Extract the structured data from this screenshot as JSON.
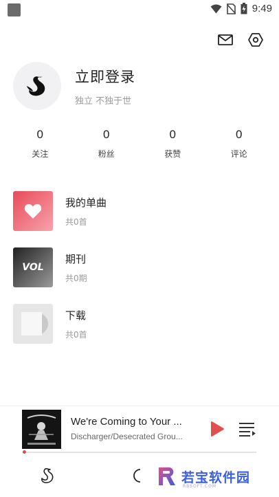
{
  "status_bar": {
    "time": "9:49",
    "icons": [
      "notification-square-icon",
      "wifi-icon",
      "no-sim-icon",
      "battery-icon"
    ]
  },
  "top_actions": {
    "icons": [
      "mail-icon",
      "settings-hexagon-icon"
    ]
  },
  "profile": {
    "title": "立即登录",
    "subtitle": "独立 不独于世"
  },
  "stats": [
    {
      "value": "0",
      "label": "关注"
    },
    {
      "value": "0",
      "label": "粉丝"
    },
    {
      "value": "0",
      "label": "获赞"
    },
    {
      "value": "0",
      "label": "评论"
    }
  ],
  "library": [
    {
      "title": "我的单曲",
      "subtitle": "共0首",
      "icon": "heart-icon"
    },
    {
      "title": "期刊",
      "subtitle": "共0期",
      "thumb_text": "VOL"
    },
    {
      "title": "下载",
      "subtitle": "共0首",
      "icon": "album-disc-icon"
    }
  ],
  "player": {
    "title": "We're Coming to Your ...",
    "artist": "Discharger/Desecrated Grou...",
    "progress_percent": 1,
    "accent": "#e24d4d"
  },
  "watermark": {
    "logo_letter": "R",
    "text": "若宝软件园",
    "small": "RBSOFT.COM"
  },
  "colors": {
    "heart_gradient_start": "#e94a59",
    "heart_gradient_end": "#f6a3ac",
    "text_primary": "#222222",
    "text_secondary": "#9a9a9a"
  }
}
